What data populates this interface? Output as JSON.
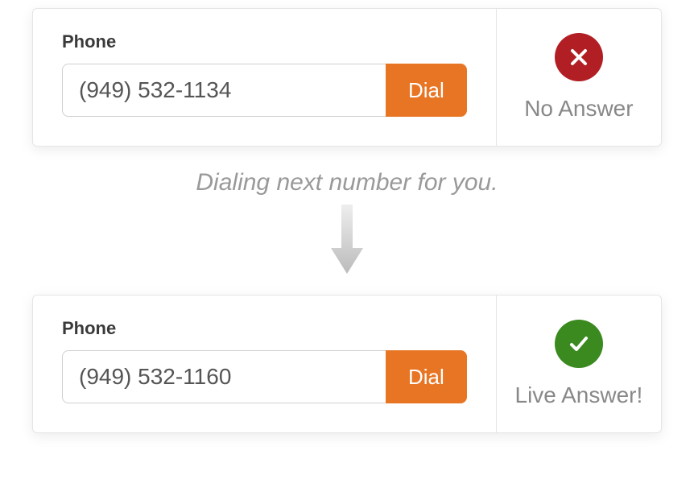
{
  "calls": [
    {
      "label": "Phone",
      "number": "(949) 532-1134",
      "dial_label": "Dial",
      "status_type": "fail",
      "status_text": "No Answer"
    },
    {
      "label": "Phone",
      "number": "(949) 532-1160",
      "dial_label": "Dial",
      "status_type": "success",
      "status_text": "Live Answer!"
    }
  ],
  "transition": {
    "text": "Dialing next number for you."
  },
  "colors": {
    "dial_button": "#e87524",
    "fail_icon": "#b11f24",
    "success_icon": "#3a8a1f",
    "status_text": "#888888"
  }
}
